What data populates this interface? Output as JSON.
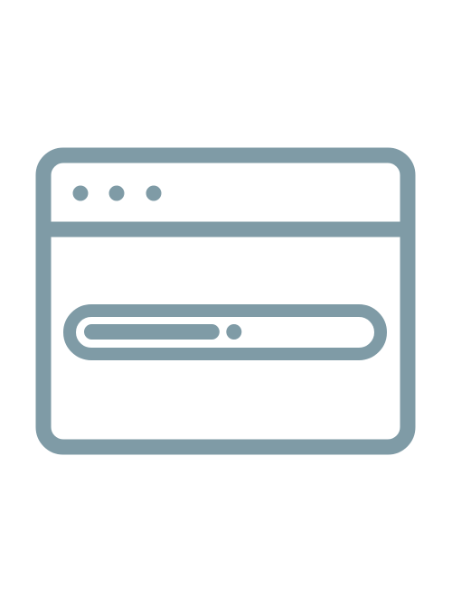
{
  "icon": {
    "name": "browser-window-loading-icon",
    "stroke_color": "#7F9BA6",
    "background": "#ffffff"
  },
  "window_controls": [
    {
      "name": "window-dot-1-icon"
    },
    {
      "name": "window-dot-2-icon"
    },
    {
      "name": "window-dot-3-icon"
    }
  ],
  "progress": {
    "value_fraction": 0.48
  }
}
